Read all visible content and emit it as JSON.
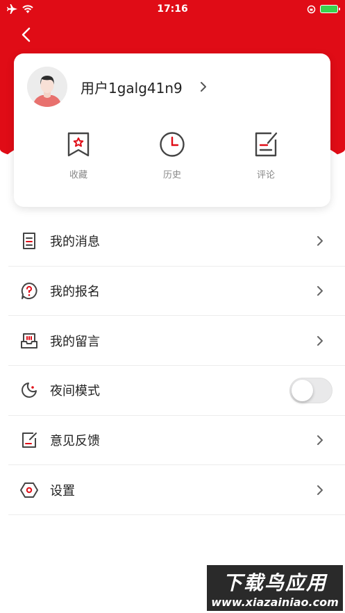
{
  "status_bar": {
    "time": "17:16"
  },
  "profile": {
    "username": "用户1galg41n9"
  },
  "shortcuts": [
    {
      "label": "收藏",
      "icon": "bookmark-icon"
    },
    {
      "label": "历史",
      "icon": "clock-icon"
    },
    {
      "label": "评论",
      "icon": "comment-edit-icon"
    }
  ],
  "menu": [
    {
      "label": "我的消息",
      "icon": "message-list-icon"
    },
    {
      "label": "我的报名",
      "icon": "question-bubble-icon"
    },
    {
      "label": "我的留言",
      "icon": "inbox-icon"
    },
    {
      "label": "夜间模式",
      "icon": "moon-icon",
      "toggle": false
    },
    {
      "label": "意见反馈",
      "icon": "feedback-edit-icon"
    },
    {
      "label": "设置",
      "icon": "settings-hexagon-icon"
    }
  ],
  "watermark": {
    "title": "下载鸟应用",
    "url": "www.xiazainiao.com"
  },
  "colors": {
    "brand_red": "#e00c16",
    "icon_red": "#e00c16",
    "icon_dark": "#444444"
  }
}
